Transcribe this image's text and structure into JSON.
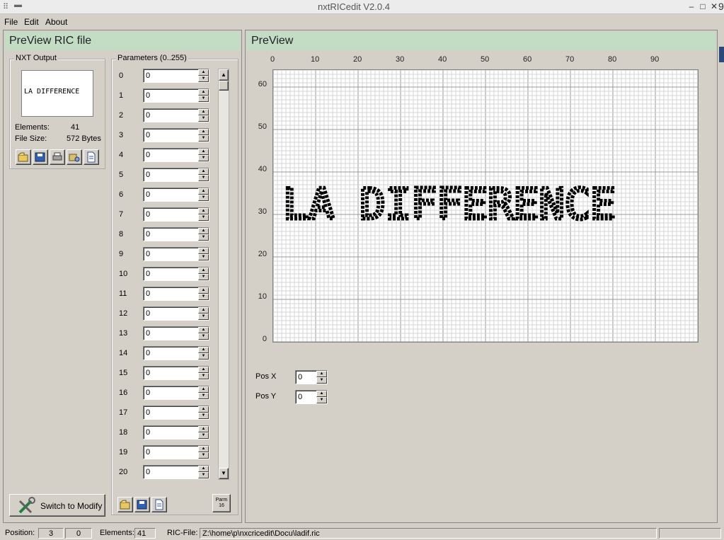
{
  "window": {
    "title": "nxtRICedit V2.0.4",
    "edge_char": "9"
  },
  "menu": [
    {
      "label": "File"
    },
    {
      "label": "Edit"
    },
    {
      "label": "About"
    }
  ],
  "left_panel": {
    "title": "PreView RIC file",
    "nxt_output": {
      "label": "NXT Output",
      "preview_text": "LA DIFFERENCE",
      "elements_label": "Elements:",
      "elements_value": "41",
      "filesize_label": "File Size:",
      "filesize_value": "572 Bytes",
      "icons": [
        "open-file-icon",
        "save-icon",
        "print-icon",
        "settings-icon",
        "page-icon"
      ]
    },
    "parameters": {
      "label": "Parameters (0..255)",
      "rows": [
        {
          "index": "0",
          "value": "0"
        },
        {
          "index": "1",
          "value": "0"
        },
        {
          "index": "2",
          "value": "0"
        },
        {
          "index": "3",
          "value": "0"
        },
        {
          "index": "4",
          "value": "0"
        },
        {
          "index": "5",
          "value": "0"
        },
        {
          "index": "6",
          "value": "0"
        },
        {
          "index": "7",
          "value": "0"
        },
        {
          "index": "8",
          "value": "0"
        },
        {
          "index": "9",
          "value": "0"
        },
        {
          "index": "10",
          "value": "0"
        },
        {
          "index": "11",
          "value": "0"
        },
        {
          "index": "12",
          "value": "0"
        },
        {
          "index": "13",
          "value": "0"
        },
        {
          "index": "14",
          "value": "0"
        },
        {
          "index": "15",
          "value": "0"
        },
        {
          "index": "16",
          "value": "0"
        },
        {
          "index": "17",
          "value": "0"
        },
        {
          "index": "18",
          "value": "0"
        },
        {
          "index": "19",
          "value": "0"
        },
        {
          "index": "20",
          "value": "0"
        }
      ],
      "parm_button": {
        "line1": "Parm",
        "line2": "16"
      }
    },
    "switch_button": "Switch to Modify"
  },
  "right_panel": {
    "title": "PreView",
    "canvas_text": "LA DIFFERENCE",
    "x_ticks": [
      "0",
      "10",
      "20",
      "30",
      "40",
      "50",
      "60",
      "70",
      "80",
      "90"
    ],
    "y_ticks": [
      "60",
      "50",
      "40",
      "30",
      "20",
      "10",
      "0"
    ],
    "pos_x": {
      "label": "Pos X",
      "value": "0"
    },
    "pos_y": {
      "label": "Pos Y",
      "value": "0"
    }
  },
  "status": {
    "position_label": "Position:",
    "position_x": "3",
    "position_y": "0",
    "elements_label": "Elements:",
    "elements_value": "41",
    "ricfile_label": "RIC-File:",
    "ricfile_path": "Z:\\home\\p\\nxcricedit\\Docu\\ladif.ric"
  }
}
